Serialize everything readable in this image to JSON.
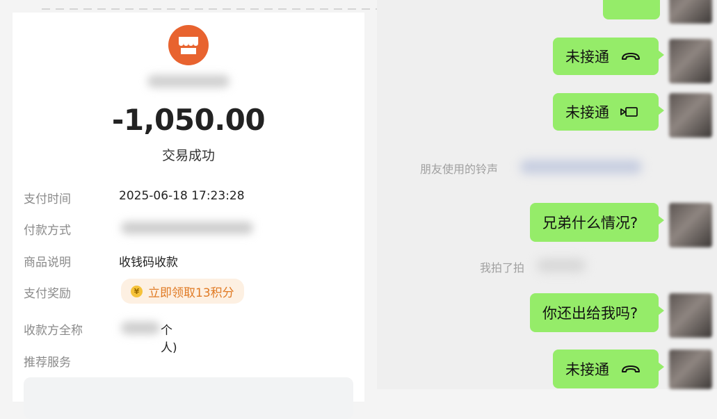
{
  "receipt": {
    "amount": "-1,050.00",
    "status": "交易成功",
    "rows": [
      {
        "label": "支付时间",
        "value": "2025-06-18 17:23:28"
      },
      {
        "label": "付款方式",
        "value": ""
      },
      {
        "label": "商品说明",
        "value": "收钱码收款"
      },
      {
        "label": "支付奖励",
        "value": "立即领取13积分"
      },
      {
        "label": "收款方全称",
        "value": "个人)"
      },
      {
        "label": "推荐服务",
        "value": ""
      }
    ],
    "merchant_icon": "store-icon",
    "accent_color": "#e8632f",
    "reward_color": "#e07a24"
  },
  "chat": {
    "messages": [
      {
        "type": "call",
        "text": "未接通",
        "icon": "phone-hangup-icon"
      },
      {
        "type": "call",
        "text": "未接通",
        "icon": "video-call-icon"
      },
      {
        "type": "system",
        "text": "朋友使用的铃声"
      },
      {
        "type": "text",
        "text": "兄弟什么情况?"
      },
      {
        "type": "system",
        "text": "我拍了拍"
      },
      {
        "type": "text",
        "text": "你还出给我吗?"
      },
      {
        "type": "call",
        "text": "未接通",
        "icon": "phone-hangup-icon"
      }
    ],
    "bubble_color": "#95ec69"
  }
}
